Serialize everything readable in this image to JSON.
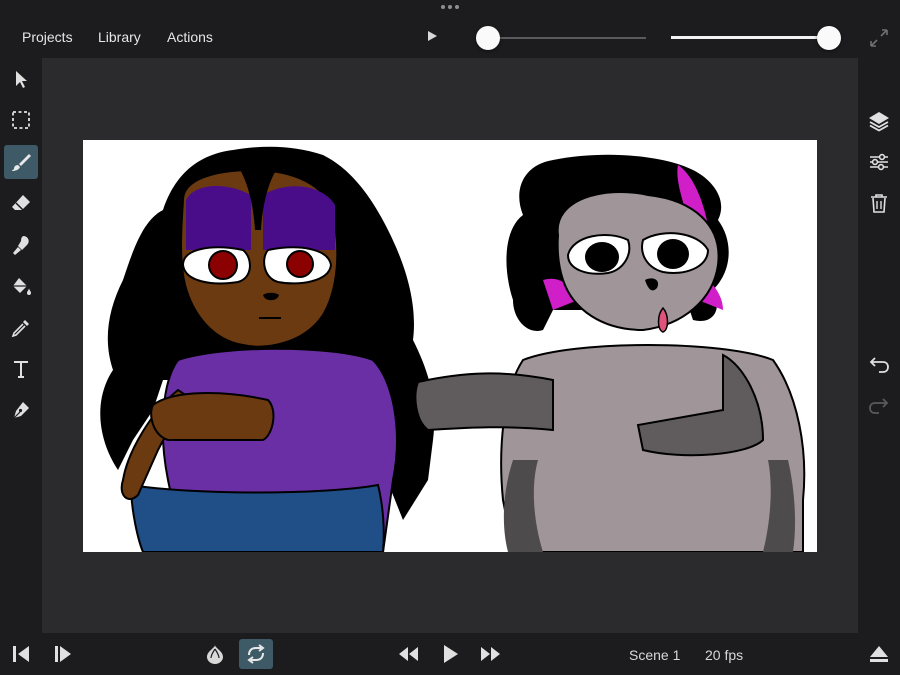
{
  "menu": {
    "projects": "Projects",
    "library": "Library",
    "actions": "Actions"
  },
  "playback": {
    "scrubber_position": 0.0,
    "opacity_level": 1.0
  },
  "left_tools": [
    "select-icon",
    "marquee-icon",
    "brush-icon",
    "eraser-icon",
    "smudge-icon",
    "fill-icon",
    "eyedropper-icon",
    "text-icon",
    "pen-icon"
  ],
  "right_tools": [
    "layers-icon",
    "adjust-icon",
    "trash-icon",
    "undo-icon",
    "redo-icon"
  ],
  "bottom": {
    "scene_label": "Scene 1",
    "fps_label": "20 fps"
  },
  "colors": {
    "accent": "#3d5a66",
    "current_color": "#000000",
    "background": "#1c1c1e",
    "stage": "#2b2b2d"
  }
}
